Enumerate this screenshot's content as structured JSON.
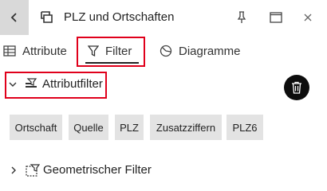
{
  "window": {
    "title": "PLZ und Ortschaften",
    "back_icon": "chevron-left-icon",
    "layer_icon": "layer-icon",
    "pin_icon": "pin-icon",
    "maximize_icon": "maximize-icon",
    "close_icon": "close-icon"
  },
  "tabs": [
    {
      "label": "Attribute",
      "icon": "table-icon"
    },
    {
      "label": "Filter",
      "icon": "funnel-icon",
      "selected": true
    },
    {
      "label": "Diagramme",
      "icon": "chart-icon"
    }
  ],
  "attribute_filter": {
    "label": "Attributfilter",
    "expanded": true,
    "icon": "attribute-filter-icon",
    "delete_icon": "trash-icon",
    "chips": [
      "Ortschaft",
      "Quelle",
      "PLZ",
      "Zusatzziffern",
      "PLZ6"
    ]
  },
  "geometric_filter": {
    "label": "Geometrischer Filter",
    "expanded": false,
    "icon": "geometric-filter-icon"
  },
  "colors": {
    "highlight": "#e0001b",
    "chip_bg": "#e3e3e3",
    "back_bg": "#d9d9d9",
    "trash_bg": "#0d0d0d"
  }
}
